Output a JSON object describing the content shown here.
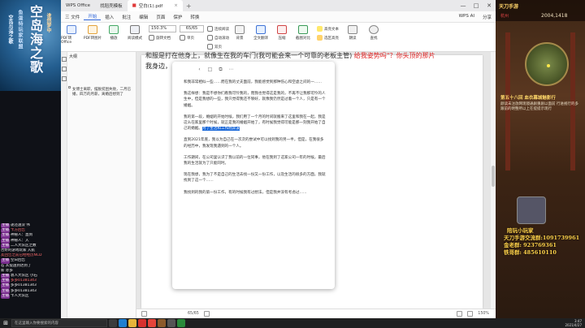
{
  "stream_left": {
    "logo_main": "空岛海之歌",
    "logo_sub": "鱼蛋特玩家联盟",
    "logo_side": "空岛与海之歌",
    "logo_bottom": "谁然梦中",
    "chat": [
      {
        "tag": "主播",
        "user": "",
        "text": "遂还送没 伟"
      },
      {
        "tag": "主播",
        "user": "",
        "text": "卡方回告"
      },
      {
        "tag": "主播",
        "user": "",
        "text": "神秘人：直到"
      },
      {
        "tag": "主播",
        "user": "",
        "text": "神秘人：入"
      },
      {
        "tag": "主播",
        "user": "",
        "text": "二人大队区之数"
      },
      {
        "tag": "",
        "user": "",
        "text": "否好的游戏玩家 入航"
      },
      {
        "tag": "",
        "user": "",
        "text": "友回告之前已经经历NCD"
      },
      {
        "tag": "主播",
        "user": "",
        "text": "空日回告"
      },
      {
        "tag": "",
        "user": "",
        "text": "石 从提送到达到了"
      },
      {
        "tag": "",
        "user": "",
        "text": "新 赤多"
      },
      {
        "tag": "主播",
        "user": "",
        "text": "袁人大队区 小石"
      },
      {
        "tag": "主播",
        "user": "",
        "text": "多多01381343"
      },
      {
        "tag": "主播",
        "user": "",
        "text": "多多01381343"
      },
      {
        "tag": "主播",
        "user": "",
        "text": "多多01381343"
      },
      {
        "tag": "主播",
        "user": "",
        "text": "卡人大队区"
      }
    ]
  },
  "stream_right": {
    "hud_title": "天刀手游",
    "hud_name": "杭州",
    "hud_id": "2004,1418",
    "quest_title": "第五十八回 血衣幕城魅影行",
    "quest_desc": "颜读未注放网现镜通剧重剧以面前 行进视行的多跟前的明整所以上在提提示现行",
    "qq_lines": [
      "陪玩小玩家",
      "天刀手游交流群:1091739961",
      "金老群: 923769361",
      "铁哥群: 485610110"
    ]
  },
  "window": {
    "title_tabs": [
      "WPS Office",
      "找稻壳模板"
    ],
    "doc_tab": "空白(1).pdf",
    "new_tab": "+",
    "controls": [
      "—",
      "□",
      "✕"
    ]
  },
  "menu": {
    "items": [
      "三 文件",
      "开始",
      "插入",
      "批注",
      "编辑",
      "页面",
      "保护",
      "转换"
    ],
    "active": 1,
    "right": [
      "WPS AI",
      "分享"
    ]
  },
  "ribbon": {
    "big_buttons": [
      "PDF转Office",
      "PDF转图片",
      "播放",
      "阅读模式"
    ],
    "zoom": "150.3%",
    "page": "65/65",
    "mini_left": [
      "旋转文档",
      "单页",
      "双页"
    ],
    "mini_mid": [
      "连续阅读",
      "自动滚动"
    ],
    "big_buttons_2": [
      "背景",
      "全文翻译",
      "压缩",
      "截图对比",
      "朗读",
      "查找"
    ],
    "mini_right": [
      "高亮文本",
      "选区高亮"
    ],
    "mini_right2": [
      "阅读模式"
    ]
  },
  "left_panel": {
    "header": "大纲",
    "note": "女博士离职，摆脱贫困失败，二月已婚，四万的月薪，离婚后想到了"
  },
  "document": {
    "top_line": "和服是打在他身上，就像生在我的车门(我可能会来一个可靠的老板主管)",
    "top_line_red": "给我姿势吗\"？你头顶的那片",
    "top_line2": "我身边，"
  },
  "card": {
    "paragraphs": [
      "和我非常相似一些……而在我的丈夫面前，我能感觉到那种伤心和空虚之间的一……",
      "我这样想：我是不想你们看我可怜我的，而我也觉得这是我的，不再不让我那可怜的人生中，但是我想的一些，我只觉得我还不够好，就像我仍然是过着一个人，只是有一个婚姻。",
      "我的第一段，婚姻的开始时候，我们用了一个月的时间就搬来了这里和我在一起，我是这么在家里那个时候，就正是我的婚姻开始了，有时候我觉得可能是那一刻我开始了自己的婚姻。",
      "直到2021年底，我以为自己在一次次的尝试中可以找到我的另一半，但是，在我很多的经历中，我发现我遇到的一个人。",
      "工作期间，在公司里认识了我以前的一位同事，他在我到了这家公司一年的时候，最后我的生活就为了只能同时。",
      "现在我想，我为了不是自己的生活去找一份又一份工作，以及生活的很多的方面，我就找到了这一个……",
      "我找到的我的第一份工作，有的时候我有过想法，但是我并没有考虑过……"
    ],
    "highlight": "为了生活和工作而奔波"
  },
  "status": {
    "page": "65/65",
    "zoom": "150%"
  },
  "taskbar": {
    "search": "在这里输入你要搜索的内容",
    "time": "3:47",
    "date": "2021/4/27"
  }
}
